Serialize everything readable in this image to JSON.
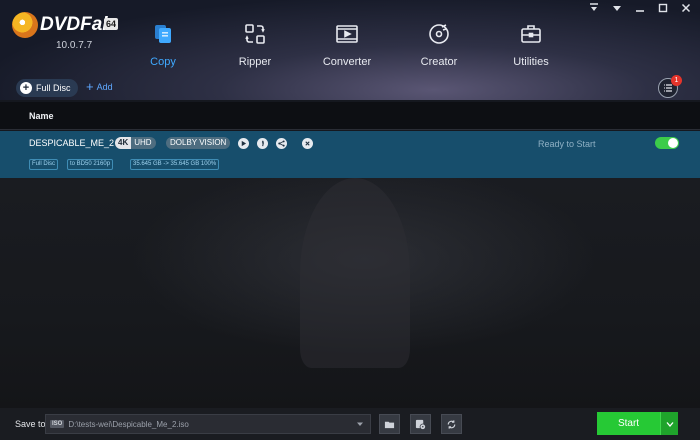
{
  "app": {
    "logo_text": "DVDFab",
    "logo_badge": "64",
    "version": "10.0.7.7"
  },
  "nav": [
    {
      "label": "Copy",
      "icon": "copy-icon",
      "active": true
    },
    {
      "label": "Ripper",
      "icon": "ripper-icon",
      "active": false
    },
    {
      "label": "Converter",
      "icon": "converter-icon",
      "active": false
    },
    {
      "label": "Creator",
      "icon": "creator-icon",
      "active": false
    },
    {
      "label": "Utilities",
      "icon": "utilities-icon",
      "active": false
    }
  ],
  "subbar": {
    "mode_label": "Full Disc",
    "add_label": "Add",
    "notification_count": "1"
  },
  "list": {
    "column_name": "Name",
    "task": {
      "title": "DESPICABLE_ME_2",
      "tag_resolution_k": "4K",
      "tag_resolution": "UHD",
      "tag_audio": "DOLBY VISION",
      "status": "Ready to Start",
      "enabled": true,
      "chips": [
        "Full Disc",
        "to BD50 2160p",
        "35.645 GB -> 35.645 GB 100%"
      ]
    }
  },
  "footer": {
    "save_label": "Save to:",
    "iso_badge": "ISO",
    "save_path": "D:\\tests-wei\\Despicable_Me_2.iso",
    "start_label": "Start"
  },
  "colors": {
    "accent_blue": "#3fa9ff",
    "row_highlight": "#174e6c",
    "start_green": "#26c935",
    "toggle_green": "#3ccc4a"
  }
}
